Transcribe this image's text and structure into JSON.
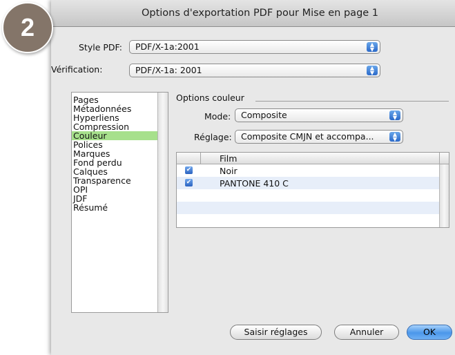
{
  "step_badge": "2",
  "window": {
    "title": "Options d'exportation PDF pour Mise en page 1"
  },
  "style_pdf": {
    "label": "Style PDF:",
    "value": "PDF/X-1a:2001"
  },
  "verification": {
    "label": "Vérification:",
    "value": "PDF/X-1a: 2001"
  },
  "sidebar": {
    "items": [
      "Pages",
      "Métadonnées",
      "Hyperliens",
      "Compression",
      "Couleur",
      "Polices",
      "Marques",
      "Fond perdu",
      "Calques",
      "Transparence",
      "OPI",
      "JDF",
      "Résumé"
    ],
    "selected": "Couleur"
  },
  "color_options": {
    "group_title": "Options couleur",
    "mode": {
      "label": "Mode:",
      "value": "Composite"
    },
    "setting": {
      "label": "Réglage:",
      "value": "Composite CMJN et accompa..."
    }
  },
  "film_table": {
    "column_header": "Film",
    "rows": [
      {
        "name": "Noir",
        "checked": true
      },
      {
        "name": "PANTONE 410 C",
        "checked": true
      }
    ]
  },
  "buttons": {
    "save_settings": "Saisir réglages",
    "cancel": "Annuler",
    "ok": "OK"
  }
}
